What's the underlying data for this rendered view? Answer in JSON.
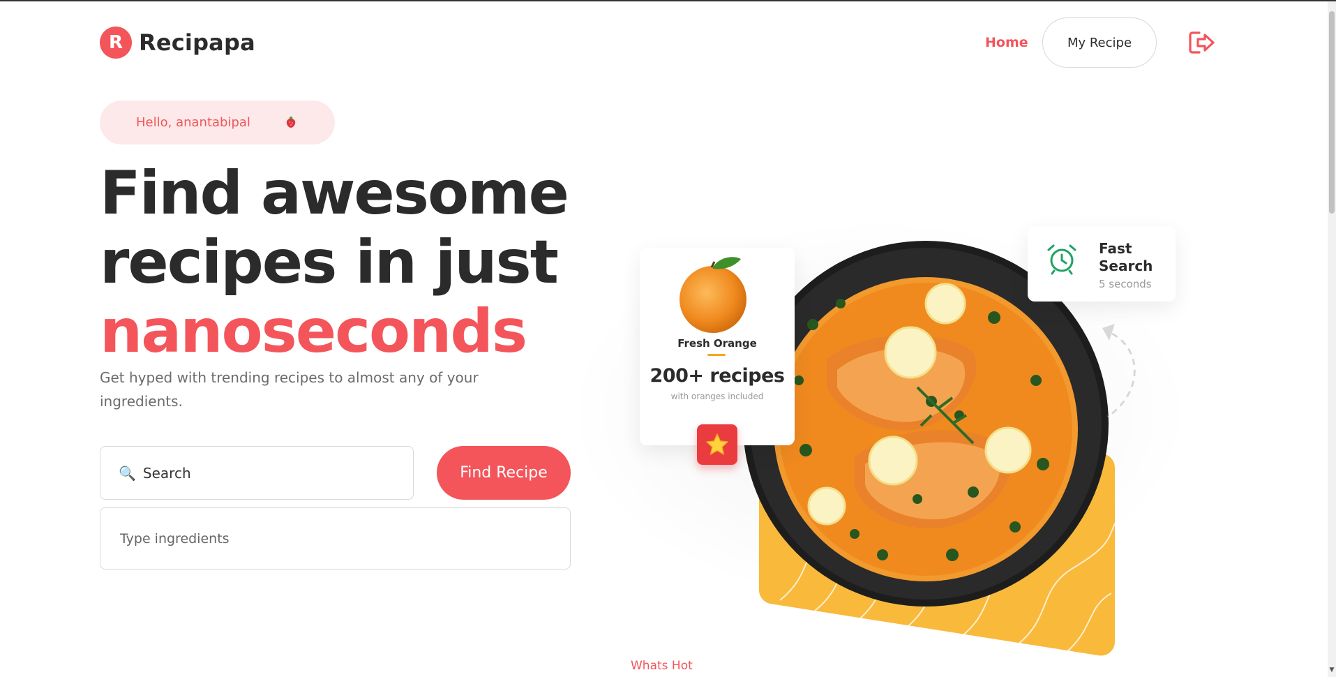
{
  "brand": {
    "logo_letter": "R",
    "name": "Recipapa",
    "color": "#f3555a"
  },
  "nav": {
    "home_label": "Home",
    "my_recipe_label": "My Recipe",
    "logout_icon": "logout-icon"
  },
  "greeting": {
    "text": "Hello, anantabipal",
    "icon": "strawberry-icon"
  },
  "hero": {
    "headline_line1": "Find awesome",
    "headline_line2": "recipes in just",
    "headline_accent": "nanoseconds",
    "subtitle": "Get hyped with trending recipes to almost any of your ingredients."
  },
  "search": {
    "icon": "🔍",
    "placeholder": "Search",
    "button_label": "Find Recipe"
  },
  "ingredients": {
    "placeholder": "Type ingredients"
  },
  "orange_card": {
    "title": "Fresh Orange",
    "count": "200+ recipes",
    "subtitle": "with oranges included",
    "badge_icon": "star-icon"
  },
  "fast_card": {
    "title": "Fast Search",
    "subtitle": "5 seconds",
    "icon": "alarm-clock-icon"
  },
  "section": {
    "whats_hot": "Whats Hot"
  },
  "colors": {
    "accent": "#f3555a",
    "dark_text": "#2b2b2b",
    "yellow": "#f9b93b",
    "green": "#1fa362"
  }
}
